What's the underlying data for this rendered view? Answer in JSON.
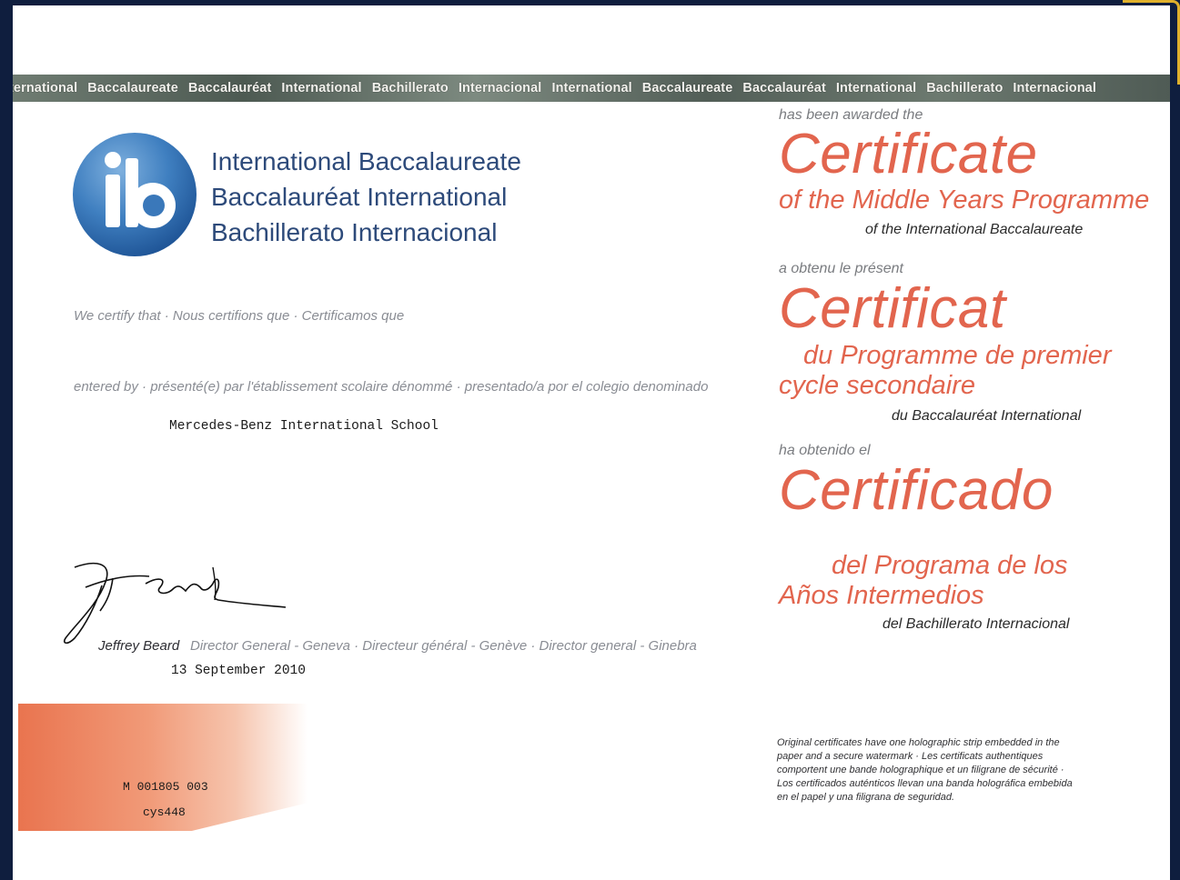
{
  "strip": {
    "words": [
      "ternational",
      "Baccalaureate",
      "Baccalauréat",
      "International",
      "Bachillerato",
      "Internacional",
      "International",
      "Baccalaureate",
      "Baccalauréat",
      "International",
      "Bachillerato",
      "Internacional"
    ]
  },
  "org": {
    "logo_letters": "ib",
    "name_en": "International Baccalaureate",
    "name_fr": "Baccalauréat International",
    "name_es": "Bachillerato Internacional"
  },
  "certify": "We certify that · Nous certifions que · Certificamos que",
  "entered_by": "entered by · présenté(e) par l'établissement scolaire dénommé · presentado/a por el colegio denominado",
  "school_name": "Mercedes-Benz International School",
  "signature": {
    "name": "Jeffrey Beard",
    "title": "Director General - Geneva · Directeur général - Genève · Director general - Ginebra",
    "date": "13 September 2010"
  },
  "codes": {
    "code1": "M 001805 003",
    "code2": "cys448"
  },
  "award": {
    "en_intro": "has been awarded the",
    "en_title": "Certificate",
    "en_programme": "of the Middle Years Programme",
    "en_org": "of the International Baccalaureate",
    "fr_intro": "a obtenu le présent",
    "fr_title": "Certificat",
    "fr_programme_1": "du Programme de premier",
    "fr_programme_2": "cycle secondaire",
    "fr_org": "du Baccalauréat International",
    "es_intro": "ha obtenido el",
    "es_title": "Certificado",
    "es_programme_1": "del Programa de los",
    "es_programme_2": "Años Intermedios",
    "es_org": "del Bachillerato Internacional"
  },
  "note": "Original certificates have one holographic strip embedded in the paper and a secure watermark · Les certificats authentiques comportent une bande holographique et un filigrane de sécurité · Los certificados auténticos llevan una banda holográfica embebida en el papel y una filigrana de seguridad.",
  "colors": {
    "accent": "#e2654e",
    "navy": "#2d4a7a",
    "background": "#0f1e3e"
  }
}
